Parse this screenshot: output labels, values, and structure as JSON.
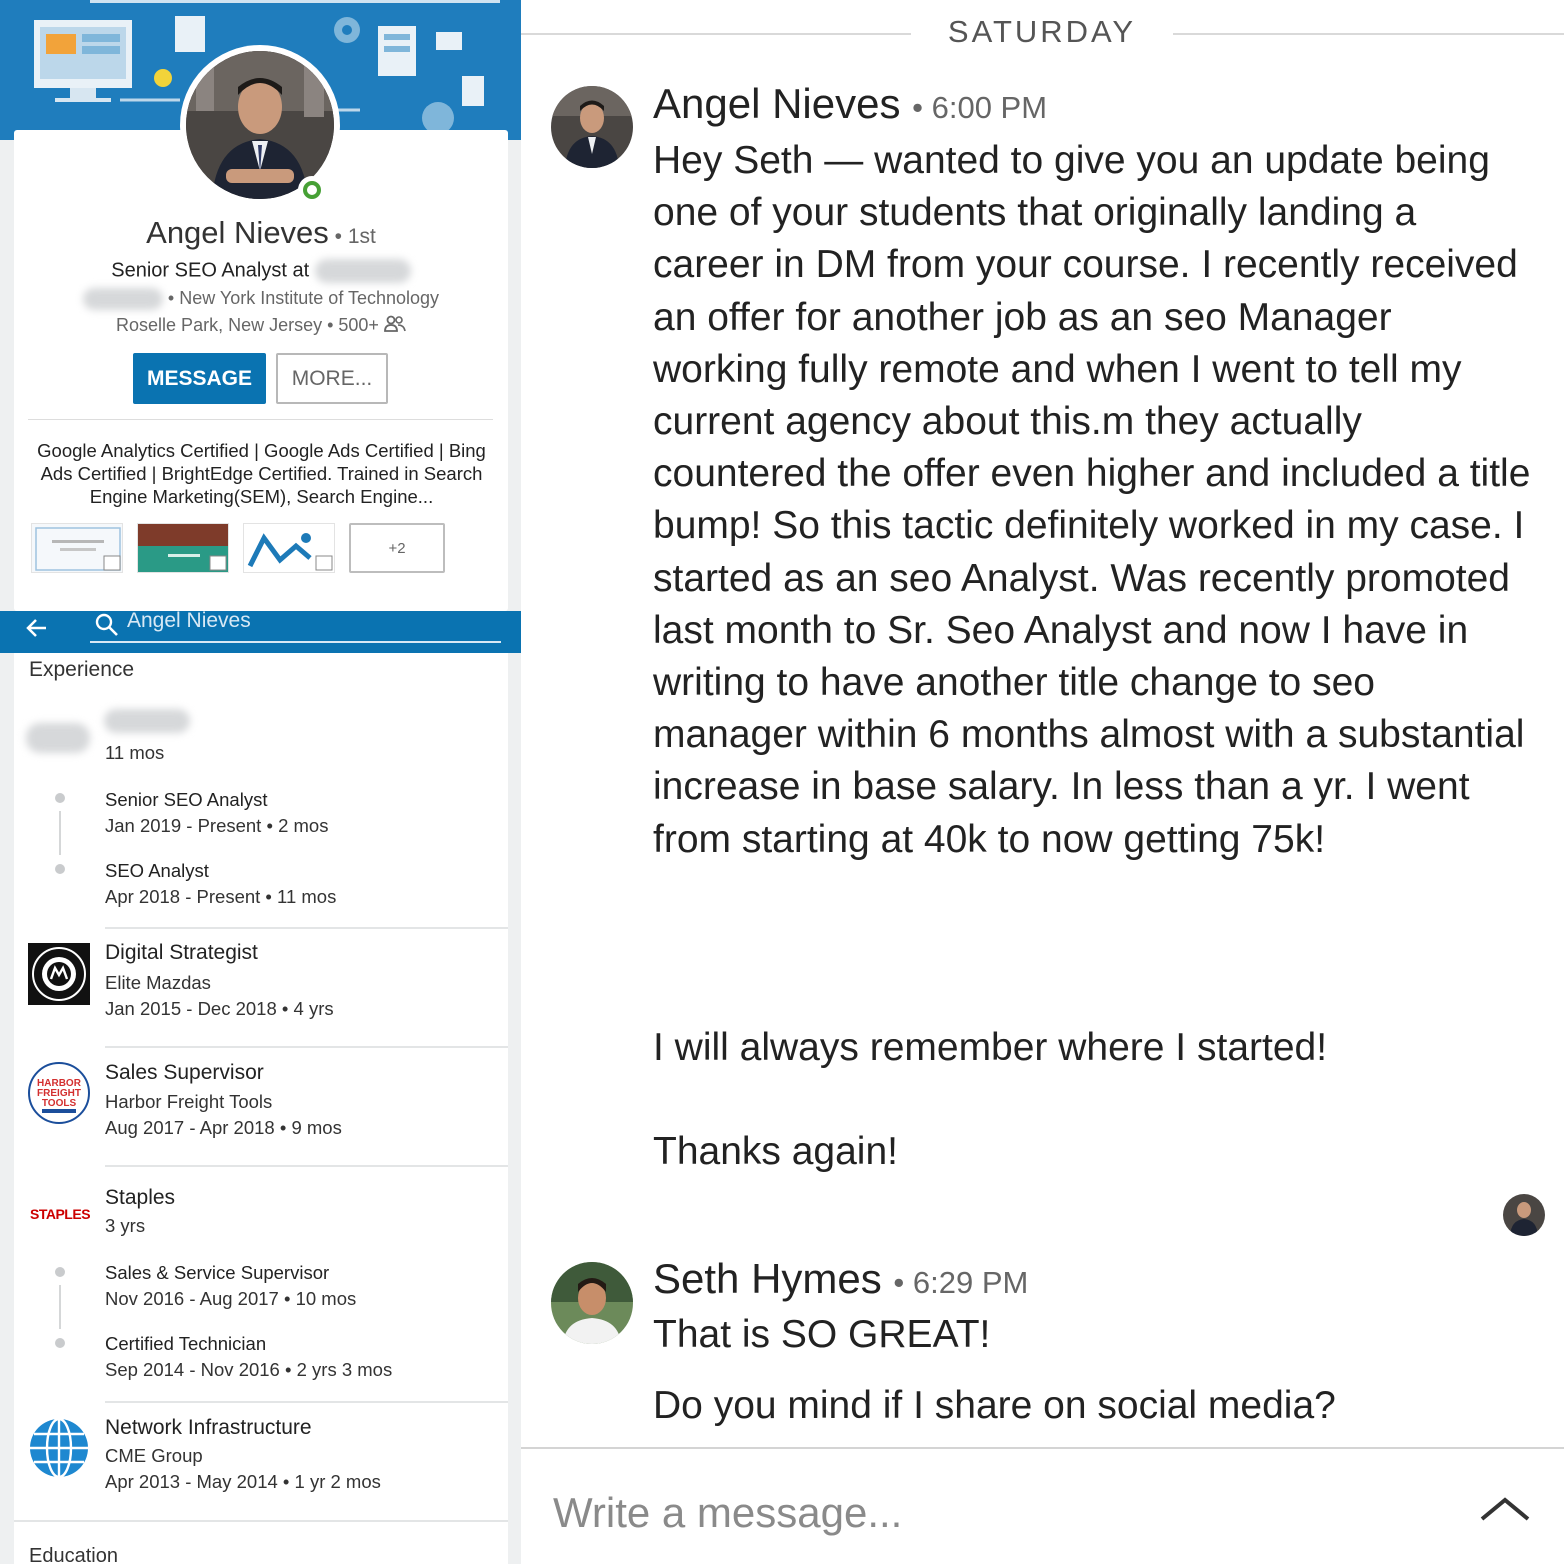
{
  "profile": {
    "name": "Angel Nieves",
    "degree": " • 1st",
    "title_prefix": "Senior SEO Analyst at",
    "school": " • New York Institute of Technology",
    "location": "Roselle Park, New Jersey • 500+",
    "message_button": "MESSAGE",
    "more_button": "MORE...",
    "summary": "Google Analytics Certified | Google Ads Certified | Bing Ads Certified | BrightEdge Certified. Trained in Search Engine Marketing(SEM), Search Engine...",
    "more_media_label": "+2"
  },
  "search": {
    "query": "Angel Nieves"
  },
  "experience": {
    "heading": "Experience",
    "first_company_duration": "11 mos",
    "roles_1": [
      {
        "title": "Senior SEO Analyst",
        "dates": "Jan 2019 - Present • 2 mos"
      },
      {
        "title": "SEO Analyst",
        "dates": "Apr 2018 - Present • 11 mos"
      }
    ],
    "jobs": [
      {
        "title": "Digital Strategist",
        "company": "Elite Mazdas",
        "dates": "Jan 2015 - Dec 2018 • 4 yrs"
      },
      {
        "title": "Sales Supervisor",
        "company": "Harbor Freight Tools",
        "dates": "Aug 2017 - Apr 2018 • 9 mos"
      }
    ],
    "staples": {
      "company": "Staples",
      "duration": "3 yrs",
      "logo_text": "STAPLES",
      "roles": [
        {
          "title": "Sales & Service Supervisor",
          "dates": "Nov 2016 - Aug 2017 • 10 mos"
        },
        {
          "title": "Certified Technician",
          "dates": "Sep 2014 - Nov 2016 • 2 yrs 3 mos"
        }
      ]
    },
    "network": {
      "title": "Network Infrastructure",
      "company": "CME Group",
      "dates": "Apr 2013 - May 2014 • 1 yr 2 mos"
    },
    "harbor_logo_text": [
      "HARBOR",
      "FREIGHT",
      "TOOLS"
    ],
    "education_heading": "Education"
  },
  "chat": {
    "day": "SATURDAY",
    "messages": [
      {
        "sender": "Angel Nieves",
        "time": "6:00 PM",
        "text": "Hey Seth — wanted to give you an update being one of your students that originally landing a career in DM from your course. I recently received an offer for another job as an seo Manager working fully remote and when I went to tell my current agency about this.m they actually countered the offer even higher and included a title bump! So this tactic definitely worked in my case. I started as an seo Analyst. Was recently promoted last month to Sr. Seo Analyst and now I have in writing to have another title change to seo manager within 6 months almost with a substantial increase in base salary. In less than a yr. I went from starting at 40k to now getting 75k!",
        "text_2": "I will always remember where I started!",
        "text_3": "Thanks again!"
      },
      {
        "sender": "Seth Hymes",
        "time": "6:29 PM",
        "text": "That is SO GREAT!",
        "text_2": "Do you mind if I share on social media?"
      }
    ],
    "compose_placeholder": "Write a message..."
  },
  "colors": {
    "linkedin_blue": "#0a73b1",
    "online_green": "#46a035",
    "staples_red": "#cc0000"
  }
}
